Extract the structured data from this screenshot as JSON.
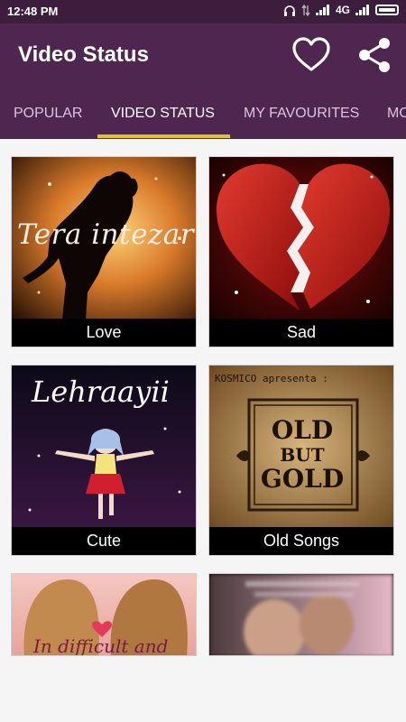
{
  "status_bar": {
    "time": "12:48 PM",
    "network": "4G"
  },
  "app_bar": {
    "title": "Video Status"
  },
  "tabs": [
    {
      "label": "POPULAR"
    },
    {
      "label": "VIDEO STATUS"
    },
    {
      "label": "MY FAVOURITES"
    },
    {
      "label": "MO"
    }
  ],
  "categories": [
    {
      "label": "Love",
      "overlay_text": "Tera intezar"
    },
    {
      "label": "Sad"
    },
    {
      "label": "Cute",
      "overlay_text": "Lehraayii"
    },
    {
      "label": "Old Songs",
      "overlay_text": "KOSMICO apresenta :",
      "badge_lines": [
        "OLD",
        "BUT",
        "GOLD"
      ]
    },
    {
      "label": "",
      "overlay_text": "In difficult and"
    },
    {
      "label": ""
    }
  ],
  "colors": {
    "primary": "#4e2650",
    "status_bar": "#3d1d3d",
    "tab_indicator": "#e5c02a"
  }
}
